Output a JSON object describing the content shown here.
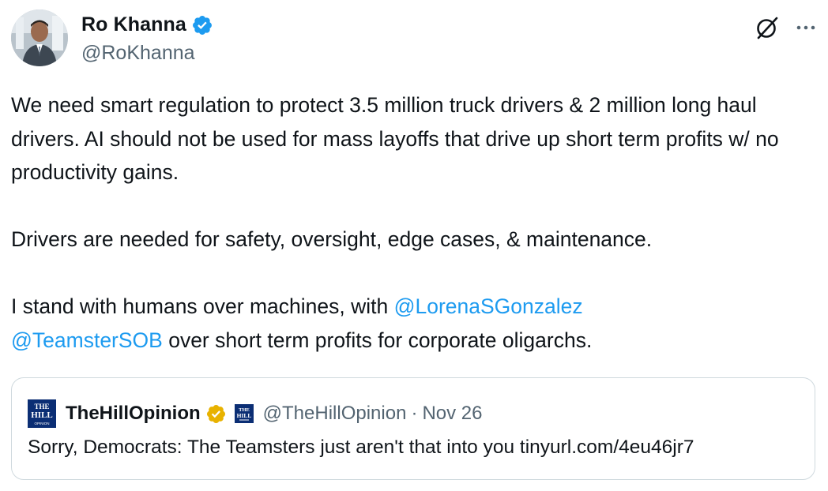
{
  "author": {
    "display_name": "Ro Khanna",
    "handle": "@RoKhanna",
    "verified": true,
    "verified_color": "#1d9bf0",
    "avatar_icon": "profile-photo"
  },
  "actions": {
    "grok_icon": "grok-icon",
    "more_icon": "more-options-icon"
  },
  "tweet": {
    "paragraph1": "We need smart regulation to protect 3.5 million truck drivers & 2 million long haul drivers. AI should not be used for mass layoffs that drive up short term profits w/ no productivity gains.",
    "paragraph2": "Drivers are needed for safety, oversight, edge cases, & maintenance.",
    "paragraph3_start": "I stand with humans over machines, with ",
    "mention1": "@LorenaSGonzalez",
    "mention2": "@TeamsterSOB",
    "paragraph3_end": " over short term profits for corporate oligarchs.",
    "mention_color": "#1d9bf0"
  },
  "quoted": {
    "display_name": "TheHillOpinion",
    "badge_color": "#e8b200",
    "handle": "@TheHillOpinion",
    "separator": "·",
    "date": "Nov 26",
    "text": "Sorry, Democrats: The Teamsters just aren't that into you tinyurl.com/4eu46jr7",
    "logo_text_top": "THE",
    "logo_text_mid": "HILL",
    "logo_text_bottom": "OPINION",
    "logo_color": "#0b2e74"
  }
}
